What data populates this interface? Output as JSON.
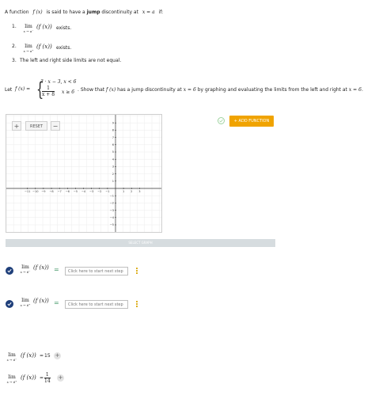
{
  "definition": {
    "intro_pre": "A function",
    "fx": "f (x)",
    "intro_mid": "is said to have a",
    "jump": "jump",
    "intro_post": "discontinuity at",
    "xa": "x = a",
    "intro_if": "if:",
    "items": [
      {
        "num": "1.",
        "lim": "lim",
        "sub": "x → a⁻",
        "expr": "(f (x))",
        "tail": "exists."
      },
      {
        "num": "2.",
        "lim": "lim",
        "sub": "x → a⁺",
        "expr": "(f (x))",
        "tail": "exists."
      },
      {
        "num": "3.",
        "text": "The left and right side limits are not equal."
      }
    ]
  },
  "problem": {
    "let": "Let",
    "fx_eq": "f (x) =",
    "piece1": "3 · x − 3,  x < 6",
    "piece2_num": "1",
    "piece2_den": "x + 8",
    "piece2_cond": "x ≥ 6",
    "show_pre": ". Show that",
    "fx": "f (x)",
    "show_mid": "has a jump discontinuity at",
    "x6": "x = 6",
    "show_post": "by graphing and evaluating the limits from the left and right at",
    "x6b": "x = 6",
    "period": "."
  },
  "graph": {
    "zoom_in": "+",
    "reset": "RESET",
    "zoom_out": "−",
    "add_function": "+ ADD FUNCTION",
    "select_graph": "SELECT GRAPH",
    "x_ticks": [
      "−11",
      "−10",
      "−9",
      "−8",
      "−7",
      "−6",
      "−5",
      "−4",
      "−3",
      "−2",
      "−1",
      "1",
      "2",
      "3"
    ],
    "y_ticks_pos": [
      "9",
      "8",
      "7",
      "6",
      "5",
      "4",
      "3",
      "2",
      "1"
    ],
    "y_ticks_neg": [
      "−1",
      "−2",
      "−3",
      "−4",
      "−5"
    ]
  },
  "limits_steps": [
    {
      "lim": "lim",
      "sub": "x → 6⁻",
      "expr": "(f (x))",
      "eq": "=",
      "placeholder": "Click here to start next step"
    },
    {
      "lim": "lim",
      "sub": "x → 6⁺",
      "expr": "(f (x))",
      "eq": "=",
      "placeholder": "Click here to start next step"
    }
  ],
  "results": [
    {
      "lim": "lim",
      "sub": "x → 6⁻",
      "expr": "(f (x))",
      "eq": "=",
      "value": "15",
      "plus": "+"
    },
    {
      "lim": "lim",
      "sub": "x → 6⁺",
      "expr": "(f (x))",
      "eq": "=",
      "num": "1",
      "den": "14",
      "plus": "+"
    }
  ],
  "colors": {
    "accent": "#f0a300",
    "check": "#1f3f7a",
    "equals": "#2e8b57"
  }
}
